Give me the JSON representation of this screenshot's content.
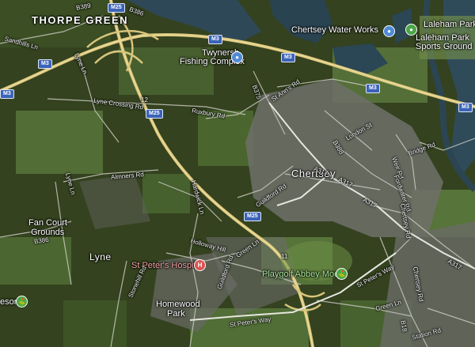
{
  "labels": {
    "thorpe_green": "THORPE GREEN",
    "chertsey": "Chertsey",
    "lyne": "Lyne",
    "twynersh": "Twynersh",
    "fishing_complex": "Fishing Complex",
    "chertsey_water_works": "Chertsey Water Works",
    "laleham_park": "Laleham Park",
    "laleham_park_sports": "Laleham Park",
    "sports_ground": "Sports Ground",
    "st_peters_hospital": "St Peter's Hospital",
    "playgolf": "Playgolf Abbey Moor",
    "homewood": "Homewood",
    "park": "Park",
    "fan_court": "Fan Court",
    "grounds": "Grounds",
    "esort": "esort"
  },
  "roads": {
    "b389": "B389",
    "b386_top": "B386",
    "sandhills": "Sandhills Ln",
    "lyne_ln_n": "Lyne Ln",
    "lyne_crossing": "Lyne Crossing Rd",
    "ruxbury": "Ruxbury Rd",
    "b375": "B375",
    "st_anns": "St Ann's Rd",
    "london_st": "London St",
    "b388": "B388",
    "a317_1": "A317",
    "a317_2": "A317",
    "a317_3": "A317",
    "a317_4": "A317",
    "bridge_rd": "Bridge Rd",
    "weir_rd": "Weir Rd",
    "fordwater": "Fordwater Rd",
    "chertsey_rd": "Chertsey Rd",
    "chertsey_rd2": "Chertsey Rd",
    "almners": "Almners Rd",
    "lyne_ln_w": "Lyne Ln",
    "b386_bottom": "B386",
    "hardwick": "Hardwick Ln",
    "guildford_rd": "Guildford Rd",
    "guildford_rd2": "Guildford Rd",
    "holloway": "Holloway Hill",
    "green_ln": "Green Ln",
    "green_ln2": "Green Ln",
    "stonehill": "Stonehill Rd",
    "st_peters_way": "St Peter's Way",
    "st_peters_way2": "St Peter's Way",
    "station_rd": "Station Rd",
    "b18": "B18"
  },
  "shields": {
    "m25_top": "M25",
    "m25_mid": "M25",
    "m25_low": "M25",
    "m3_1": "M3",
    "m3_2": "M3",
    "m3_3": "M3",
    "m3_4": "M3",
    "m3_5": "M3",
    "m3_6": "M3",
    "j12": "12",
    "j11": "11"
  },
  "pins": {
    "fishing": "●",
    "waterworks": "●",
    "laleham": "●",
    "hospital": "H",
    "golf": "⛳",
    "resort": "⛳"
  },
  "colors": {
    "motorway": "#d9c37a",
    "water": "#2c4553",
    "field_light": "#4f6b33",
    "urban": "#6d6f6a"
  }
}
